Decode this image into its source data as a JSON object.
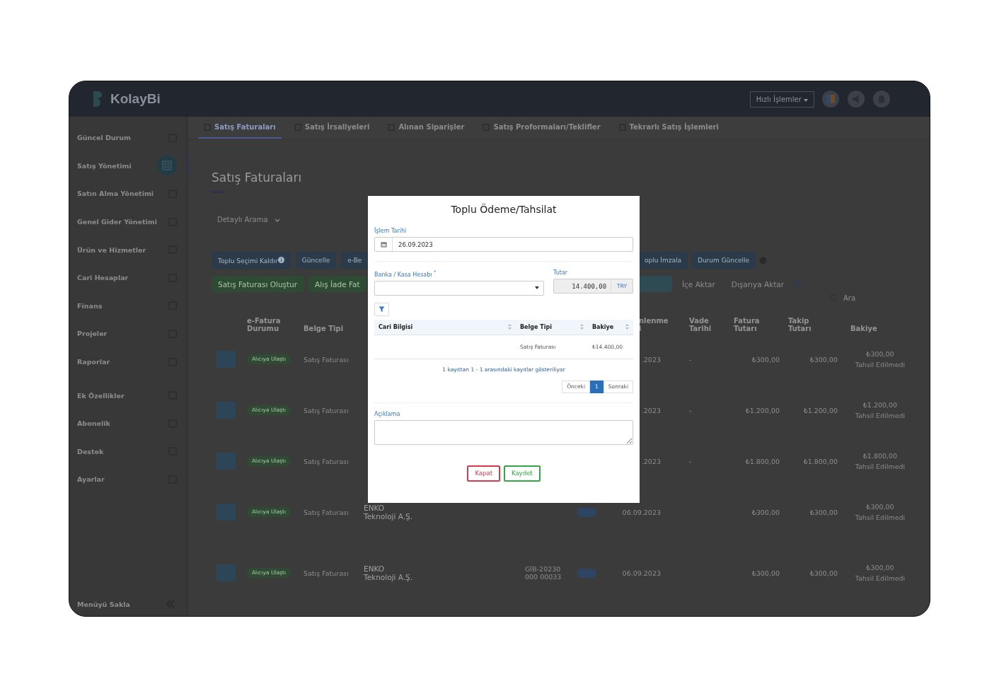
{
  "header": {
    "logo": "KolayBi",
    "quick_actions": "Hızlı İşlemler"
  },
  "sidebar": {
    "items": [
      {
        "label": "Güncel Durum",
        "selected": false
      },
      {
        "label": "Satış Yönetimi",
        "selected": true
      },
      {
        "label": "Satın Alma Yönetimi",
        "selected": false
      },
      {
        "label": "Genel Gider Yönetimi",
        "selected": false
      },
      {
        "label": "Ürün ve Hizmetler",
        "selected": false
      },
      {
        "label": "Cari Hesaplar",
        "selected": false
      },
      {
        "label": "Finans",
        "selected": false
      },
      {
        "label": "Projeler",
        "selected": false
      },
      {
        "label": "Raporlar",
        "selected": false
      },
      {
        "label": "Ek Özellikler",
        "selected": false
      },
      {
        "label": "Abonelik",
        "selected": false
      },
      {
        "label": "Destek",
        "selected": false
      },
      {
        "label": "Ayarlar",
        "selected": false
      }
    ],
    "collapse": "Menüyü Sakla"
  },
  "tabs": [
    {
      "label": "Satış Faturaları",
      "selected": true
    },
    {
      "label": "Satış İrsaliyeleri",
      "selected": false
    },
    {
      "label": "Alınan Siparişler",
      "selected": false
    },
    {
      "label": "Satış Proformaları/Teklifler",
      "selected": false
    },
    {
      "label": "Tekrarlı Satış İşlemleri",
      "selected": false
    }
  ],
  "page_title": "Satış Faturaları",
  "detailed_search": "Detaylı Arama",
  "toolbar": {
    "row_1_left": [
      {
        "label": "Toplu Seçimi Kaldır",
        "kind": "primary",
        "info": true
      },
      {
        "label": "Güncelle",
        "kind": "primary",
        "info": false
      },
      {
        "label": "e-Be",
        "kind": "primary",
        "info": false
      }
    ],
    "row_1_right": [
      {
        "label": "oplu İmzala",
        "kind": "primary",
        "info": false
      },
      {
        "label": "Durum Güncelle",
        "kind": "primary",
        "info": false
      }
    ],
    "row_2_left": [
      {
        "label": "Satış Faturası Oluştur",
        "kind": "success",
        "info": false
      },
      {
        "label": "Alış İade Fat",
        "kind": "success",
        "info": false
      }
    ],
    "row_2_right": [
      {
        "kind": "teal",
        "info": false
      },
      {
        "label": "İçe Aktar",
        "kind": "plain",
        "info": false
      },
      {
        "label": "Dışarıya Aktar",
        "kind": "plain",
        "info": false
      }
    ],
    "search_placeholder": "Ara"
  },
  "table": {
    "columns": [
      "",
      "e-Fatura Durumu",
      "Belge Tipi",
      "",
      "",
      "",
      "nlenme i",
      "Vade Tarihi",
      "Fatura Tutarı",
      "Takip Tutarı",
      "Bakiye"
    ],
    "rows": [
      {
        "status": "Alıcıya Ulaştı",
        "type": "Satış Faturası",
        "customer": "",
        "number": "",
        "date": ".2023",
        "due": "-",
        "invoice": "₺300,00",
        "tracking": "₺300,00",
        "balance": "₺300,00",
        "balance_state": "Tahsil Edilmedi"
      },
      {
        "status": "Alıcıya Ulaştı",
        "type": "Satış Faturası",
        "customer": "",
        "number": "",
        "date": ".2023",
        "due": "-",
        "invoice": "₺1.200,00",
        "tracking": "₺1.200,00",
        "balance": "₺1.200,00",
        "balance_state": "Tahsil Edilmedi"
      },
      {
        "status": "Alıcıya Ulaştı",
        "type": "Satış Faturası",
        "customer": "",
        "number": "",
        "date": ".2023",
        "due": "-",
        "invoice": "₺1.800,00",
        "tracking": "₺1.800,00",
        "balance": "₺1.800,00",
        "balance_state": "Tahsil Edilmedi"
      },
      {
        "status": "Alıcıya Ulaştı",
        "type": "Satış Faturası",
        "customer": "ENKO Teknoloji A.Ş.",
        "number": "",
        "badge": true,
        "date": "06.09.2023",
        "due": "",
        "invoice": "₺300,00",
        "tracking": "₺300,00",
        "balance": "₺300,00",
        "balance_state": "Tahsil Edilmedi"
      },
      {
        "status": "Alıcıya Ulaştı",
        "type": "Satış Faturası",
        "customer": "ENKO Teknoloji A.Ş.",
        "number": "GİB-20230000 00033",
        "badge": true,
        "date": "06.09.2023",
        "due": "",
        "invoice": "₺300,00",
        "tracking": "₺300,00",
        "balance": "₺300,00",
        "balance_state": "Tahsil Edilmedi"
      }
    ]
  },
  "modal": {
    "title": "Toplu Ödeme/Tahsilat",
    "date_label": "İşlem Tarihi",
    "date_value": "26.09.2023",
    "account_label": "Banka / Kasa Hesabı $^{*}$",
    "amount_label": "Tutar",
    "amount_value": "14.400,00",
    "currency": "TRY",
    "columns": [
      "Cari Bilgisi",
      "Belge Tipi",
      "Bakiye"
    ],
    "rows": [
      {
        "customer": "",
        "type": "Satış Faturası",
        "balance": "₺14.400,00"
      }
    ],
    "info": "1 kayıttan 1 - 1 arasındaki kayıtlar gösteriliyor",
    "pagination": [
      {
        "label": "Önceki",
        "selected": false
      },
      {
        "label": "1",
        "selected": true
      },
      {
        "label": "Sonraki",
        "selected": false
      }
    ],
    "note_label": "Açıklama",
    "buttons": [
      {
        "label": "Kapat",
        "kind": "danger"
      },
      {
        "label": "Kaydet",
        "kind": "success"
      }
    ]
  }
}
